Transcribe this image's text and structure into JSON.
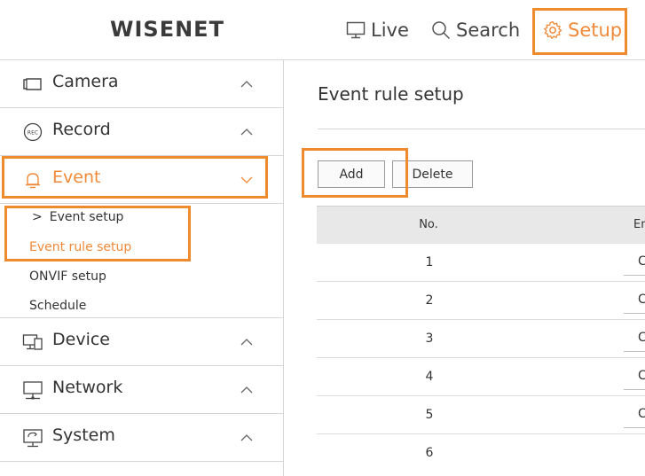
{
  "header": {
    "logo": "WISENET",
    "nav": [
      {
        "label": "Live",
        "icon": "monitor-icon"
      },
      {
        "label": "Search",
        "icon": "search-icon"
      },
      {
        "label": "Setup",
        "icon": "gear-icon",
        "active": true
      }
    ]
  },
  "sidebar": {
    "menus": [
      {
        "label": "Camera",
        "icon": "camera-icon"
      },
      {
        "label": "Record",
        "icon": "rec-icon",
        "icon_text": "REC"
      },
      {
        "label": "Event",
        "icon": "bell-icon",
        "active": true
      },
      {
        "label": "Device",
        "icon": "device-icon"
      },
      {
        "label": "Network",
        "icon": "network-icon"
      },
      {
        "label": "System",
        "icon": "system-icon"
      }
    ],
    "event_submenu": [
      {
        "label": "Event setup",
        "marker": ">"
      },
      {
        "label": "Event rule setup",
        "active": true
      },
      {
        "label": "ONVIF setup"
      },
      {
        "label": "Schedule"
      }
    ]
  },
  "main": {
    "title": "Event rule setup",
    "buttons": {
      "add": "Add",
      "delete": "Delete"
    },
    "table": {
      "columns": [
        "No.",
        "En"
      ],
      "rows": [
        {
          "no": "1",
          "en": "C"
        },
        {
          "no": "2",
          "en": "C"
        },
        {
          "no": "3",
          "en": "C"
        },
        {
          "no": "4",
          "en": "C"
        },
        {
          "no": "5",
          "en": "C"
        },
        {
          "no": "6",
          "en": ""
        }
      ]
    }
  },
  "colors": {
    "accent": "#f08a3a",
    "highlight": "#f08a2e",
    "border": "#d6d6d6",
    "table_header": "#e8e8e8"
  }
}
